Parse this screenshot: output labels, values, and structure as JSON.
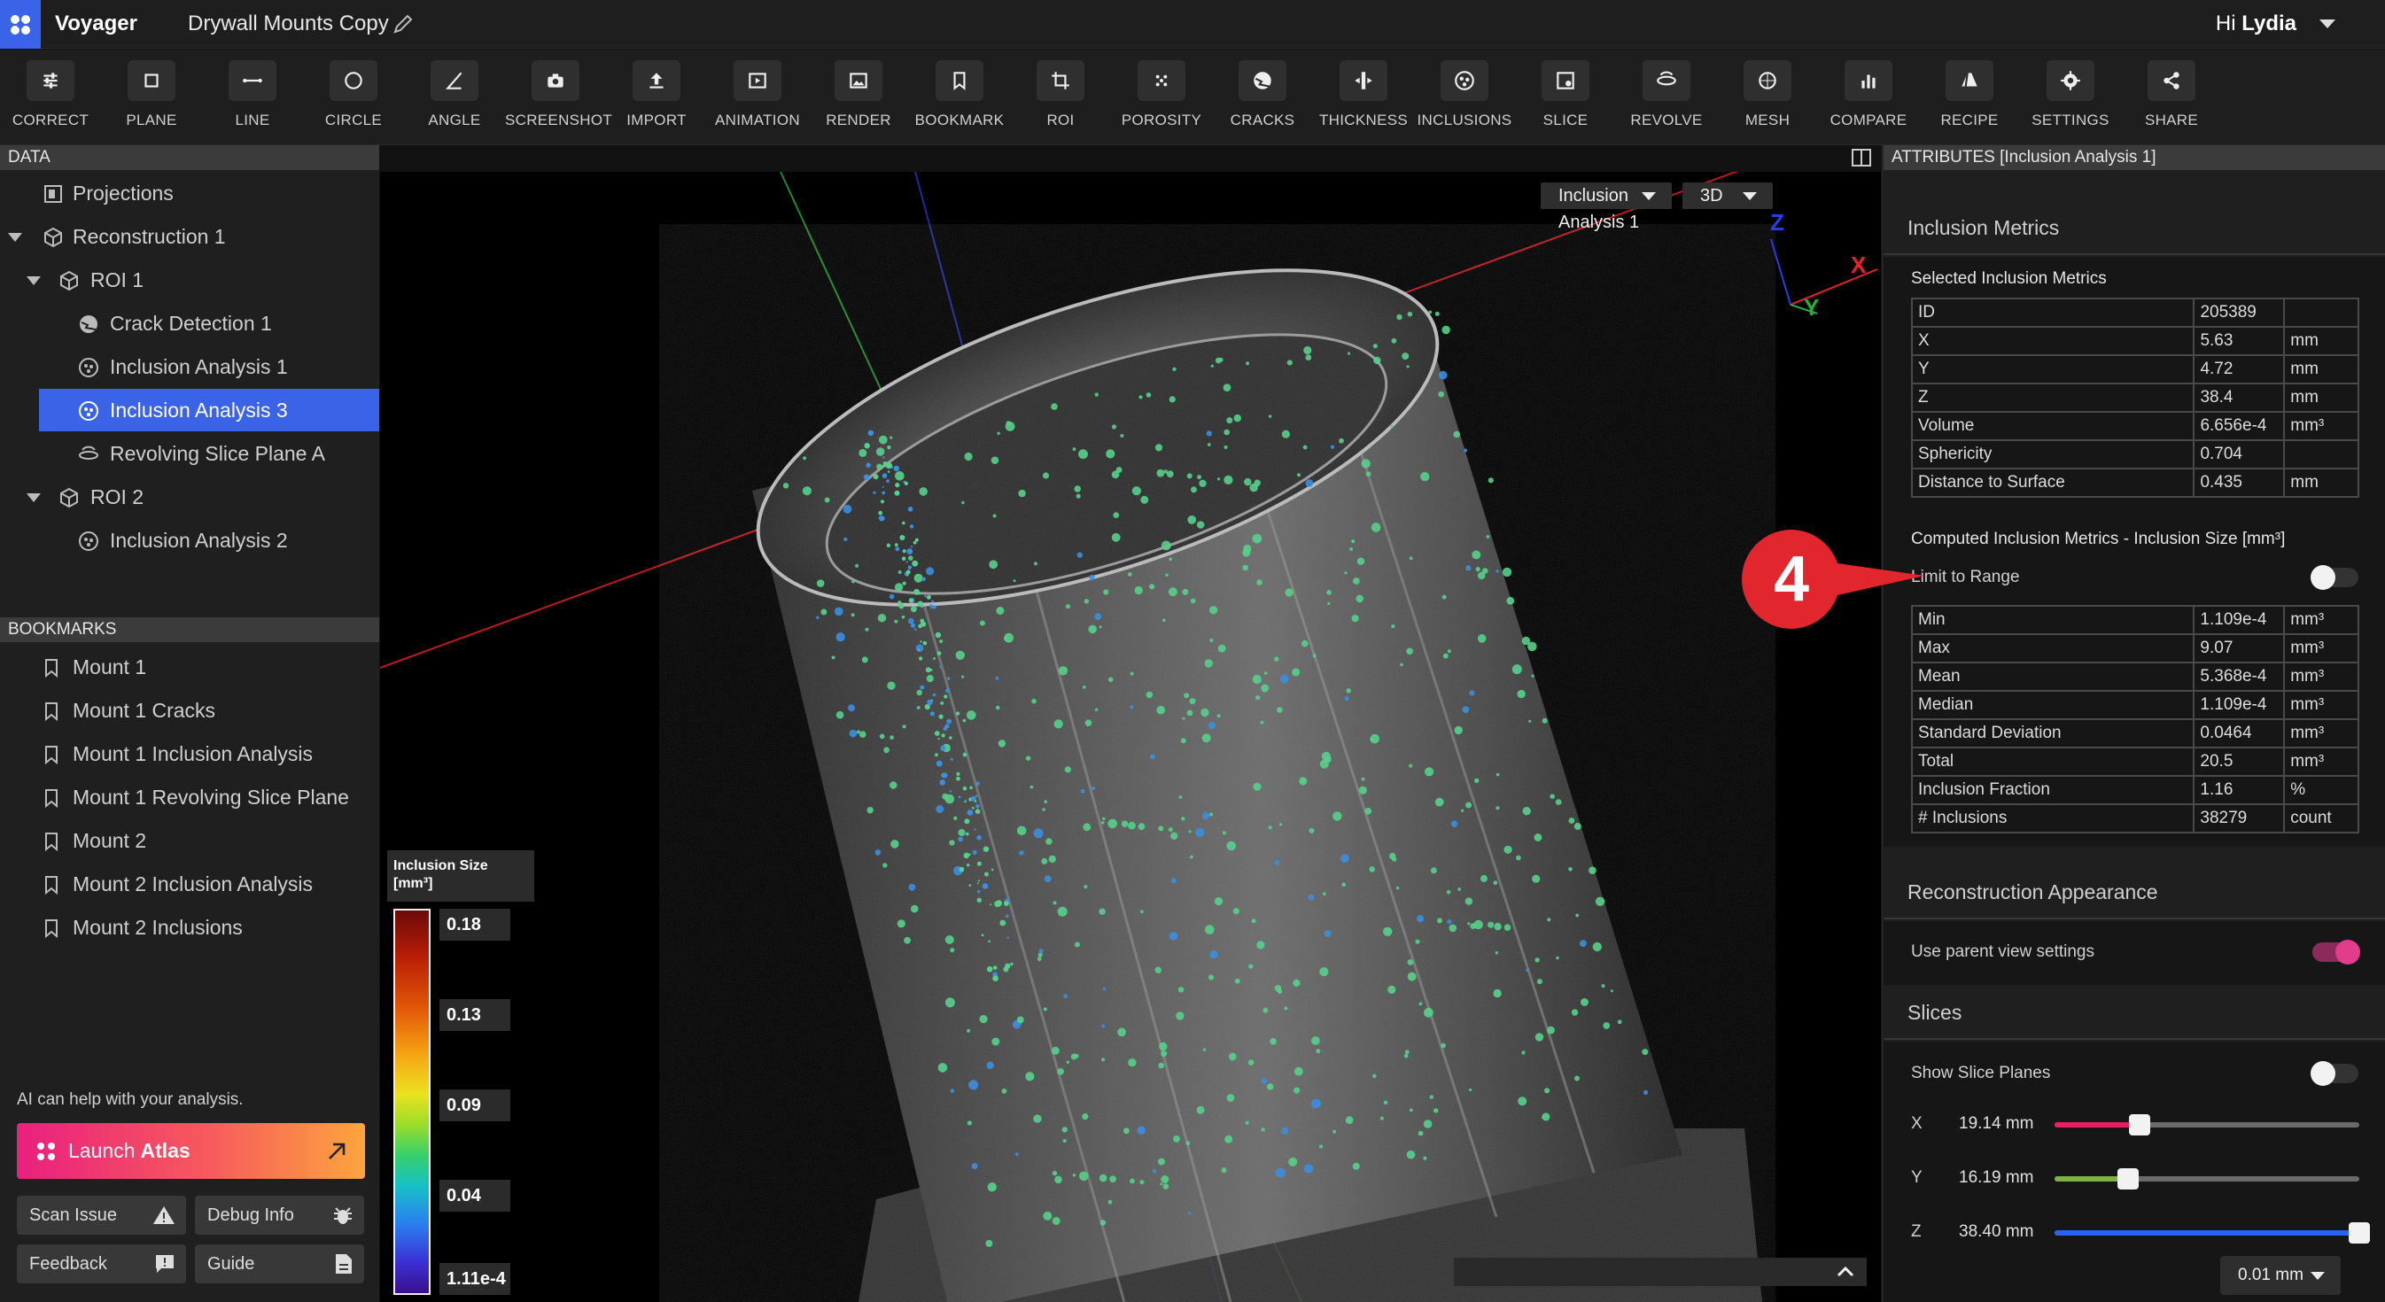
{
  "app": {
    "name": "Voyager",
    "document_title": "Drywall Mounts Copy",
    "greeting_prefix": "Hi",
    "user_name": "Lydia"
  },
  "toolbar": [
    {
      "id": "correct",
      "label": "CORRECT",
      "icon": "sliders-icon"
    },
    {
      "id": "plane",
      "label": "PLANE",
      "icon": "square-icon"
    },
    {
      "id": "line",
      "label": "LINE",
      "icon": "line-icon"
    },
    {
      "id": "circle",
      "label": "CIRCLE",
      "icon": "circle-icon"
    },
    {
      "id": "angle",
      "label": "ANGLE",
      "icon": "angle-icon"
    },
    {
      "id": "screenshot",
      "label": "SCREENSHOT",
      "icon": "camera-icon"
    },
    {
      "id": "import",
      "label": "IMPORT",
      "icon": "upload-icon"
    },
    {
      "id": "animation",
      "label": "ANIMATION",
      "icon": "play-icon"
    },
    {
      "id": "render",
      "label": "RENDER",
      "icon": "image-icon"
    },
    {
      "id": "bookmark",
      "label": "BOOKMARK",
      "icon": "bookmark-icon"
    },
    {
      "id": "roi",
      "label": "ROI",
      "icon": "crop-icon"
    },
    {
      "id": "porosity",
      "label": "POROSITY",
      "icon": "porosity-icon"
    },
    {
      "id": "cracks",
      "label": "CRACKS",
      "icon": "cracks-icon"
    },
    {
      "id": "thickness",
      "label": "THICKNESS",
      "icon": "thickness-icon"
    },
    {
      "id": "inclusions",
      "label": "INCLUSIONS",
      "icon": "inclusions-icon"
    },
    {
      "id": "slice",
      "label": "SLICE",
      "icon": "slice-icon"
    },
    {
      "id": "revolve",
      "label": "REVOLVE",
      "icon": "revolve-icon"
    },
    {
      "id": "mesh",
      "label": "MESH",
      "icon": "mesh-icon"
    },
    {
      "id": "compare",
      "label": "COMPARE",
      "icon": "bar-chart-icon"
    },
    {
      "id": "recipe",
      "label": "RECIPE",
      "icon": "recipe-icon"
    },
    {
      "id": "settings",
      "label": "SETTINGS",
      "icon": "gear-icon"
    },
    {
      "id": "share",
      "label": "SHARE",
      "icon": "share-icon"
    }
  ],
  "data_panel": {
    "header": "DATA",
    "tree": [
      {
        "label": "Projections",
        "icon": "projections-icon",
        "level": 0,
        "expanded": null,
        "selected": false
      },
      {
        "label": "Reconstruction 1",
        "icon": "cube-icon",
        "level": 0,
        "expanded": true,
        "selected": false
      },
      {
        "label": "ROI 1",
        "icon": "cube-icon",
        "level": 1,
        "expanded": true,
        "selected": false
      },
      {
        "label": "Crack Detection 1",
        "icon": "cracks-icon",
        "level": 2,
        "expanded": null,
        "selected": false
      },
      {
        "label": "Inclusion Analysis 1",
        "icon": "inclusions-icon",
        "level": 2,
        "expanded": null,
        "selected": false
      },
      {
        "label": "Inclusion Analysis 3",
        "icon": "inclusions-icon",
        "level": 2,
        "expanded": null,
        "selected": true
      },
      {
        "label": "Revolving Slice Plane A",
        "icon": "revolve-icon",
        "level": 2,
        "expanded": null,
        "selected": false
      },
      {
        "label": "ROI 2",
        "icon": "cube-icon",
        "level": 1,
        "expanded": true,
        "selected": false
      },
      {
        "label": "Inclusion Analysis 2",
        "icon": "inclusions-icon",
        "level": 2,
        "expanded": null,
        "selected": false
      }
    ]
  },
  "bookmarks_panel": {
    "header": "BOOKMARKS",
    "items": [
      "Mount 1",
      "Mount 1 Cracks",
      "Mount 1 Inclusion Analysis",
      "Mount 1 Revolving Slice Plane",
      "Mount 2",
      "Mount 2 Inclusion Analysis",
      "Mount 2 Inclusions"
    ]
  },
  "sidebar_footer": {
    "ai_help": "AI can help with your analysis.",
    "launch_prefix": "Launch",
    "launch_name": "Atlas",
    "scan_issue": "Scan Issue",
    "debug_info": "Debug Info",
    "feedback": "Feedback",
    "guide": "Guide"
  },
  "viewport": {
    "analysis_select": "Inclusion Analysis 1",
    "view_mode": "3D",
    "axis_x": "X",
    "axis_y": "Y",
    "axis_z": "Z",
    "colors": {
      "x_axis": "#e8202a",
      "y_axis": "#23b33a",
      "z_axis": "#2a3ce8",
      "inclusion": "#55d08a"
    }
  },
  "legend": {
    "title": "Inclusion Size [mm³]",
    "ticks": [
      "0.18",
      "0.13",
      "0.09",
      "0.04",
      "1.11e-4"
    ]
  },
  "attributes": {
    "header": "ATTRIBUTES [Inclusion Analysis 1]",
    "inclusion_metrics_title": "Inclusion Metrics",
    "selected_title": "Selected Inclusion Metrics",
    "selected_rows": [
      {
        "k": "ID",
        "v": "205389",
        "u": ""
      },
      {
        "k": "X",
        "v": "5.63",
        "u": "mm"
      },
      {
        "k": "Y",
        "v": "4.72",
        "u": "mm"
      },
      {
        "k": "Z",
        "v": "38.4",
        "u": "mm"
      },
      {
        "k": "Volume",
        "v": "6.656e-4",
        "u": "mm³"
      },
      {
        "k": "Sphericity",
        "v": "0.704",
        "u": ""
      },
      {
        "k": "Distance to Surface",
        "v": "0.435",
        "u": "mm"
      }
    ],
    "computed_title": "Computed Inclusion Metrics - Inclusion Size [mm³]",
    "limit_to_range": "Limit to Range",
    "limit_to_range_on": false,
    "computed_rows": [
      {
        "k": "Min",
        "v": "1.109e-4",
        "u": "mm³"
      },
      {
        "k": "Max",
        "v": "9.07",
        "u": "mm³"
      },
      {
        "k": "Mean",
        "v": "5.368e-4",
        "u": "mm³"
      },
      {
        "k": "Median",
        "v": "1.109e-4",
        "u": "mm³"
      },
      {
        "k": "Standard Deviation",
        "v": "0.0464",
        "u": "mm³"
      },
      {
        "k": "Total",
        "v": "20.5",
        "u": "mm³"
      },
      {
        "k": "Inclusion Fraction",
        "v": "1.16",
        "u": "%"
      },
      {
        "k": "# Inclusions",
        "v": "38279",
        "u": "count"
      }
    ],
    "reconstruction_title": "Reconstruction Appearance",
    "use_parent": "Use parent view settings",
    "use_parent_on": true,
    "slices_title": "Slices",
    "show_slice_planes": "Show Slice Planes",
    "show_slice_planes_on": false,
    "sliders": [
      {
        "axis": "X",
        "value": "19.14 mm",
        "fraction": 0.28,
        "color": "#e91e63"
      },
      {
        "axis": "Y",
        "value": "16.19 mm",
        "fraction": 0.24,
        "color": "#7cb342"
      },
      {
        "axis": "Z",
        "value": "38.40 mm",
        "fraction": 1.0,
        "color": "#2962ff"
      }
    ],
    "step": "0.01 mm"
  },
  "callout": {
    "number": "4",
    "color": "#e1262d"
  }
}
